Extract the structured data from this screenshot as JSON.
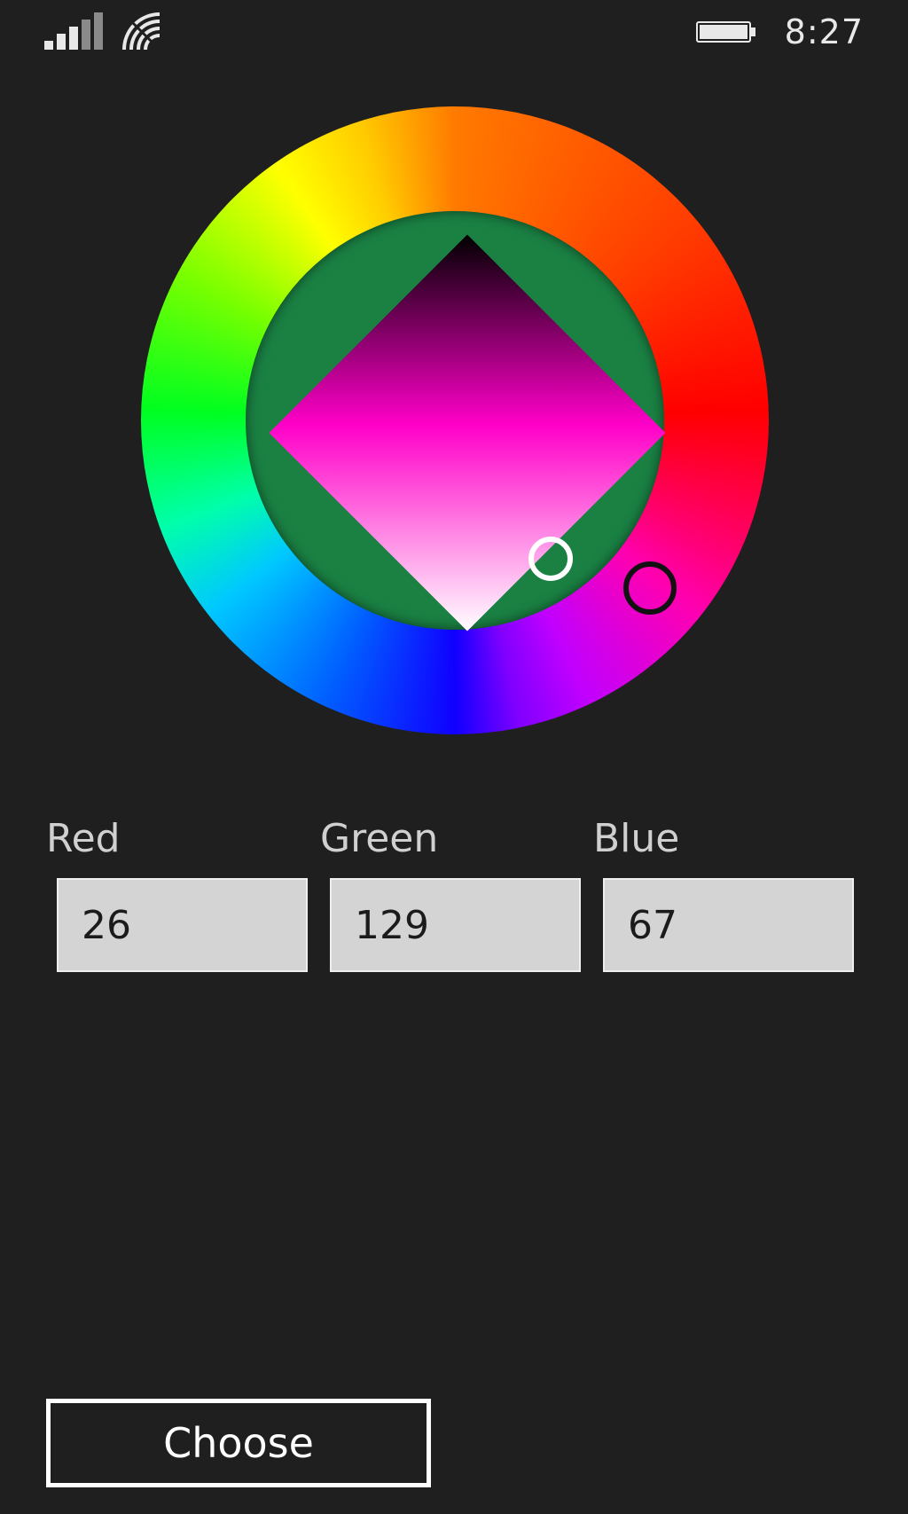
{
  "status_bar": {
    "time": "8:27",
    "signal_icon": "signal-strength-icon",
    "wifi_icon": "wifi-icon",
    "battery_icon": "battery-icon"
  },
  "color_picker": {
    "selected_hue_color": "#ff00c8",
    "selected_color": "#1a8143"
  },
  "fields": {
    "red": {
      "label": "Red",
      "value": "26"
    },
    "green": {
      "label": "Green",
      "value": "129"
    },
    "blue": {
      "label": "Blue",
      "value": "67"
    }
  },
  "actions": {
    "choose_label": "Choose"
  }
}
